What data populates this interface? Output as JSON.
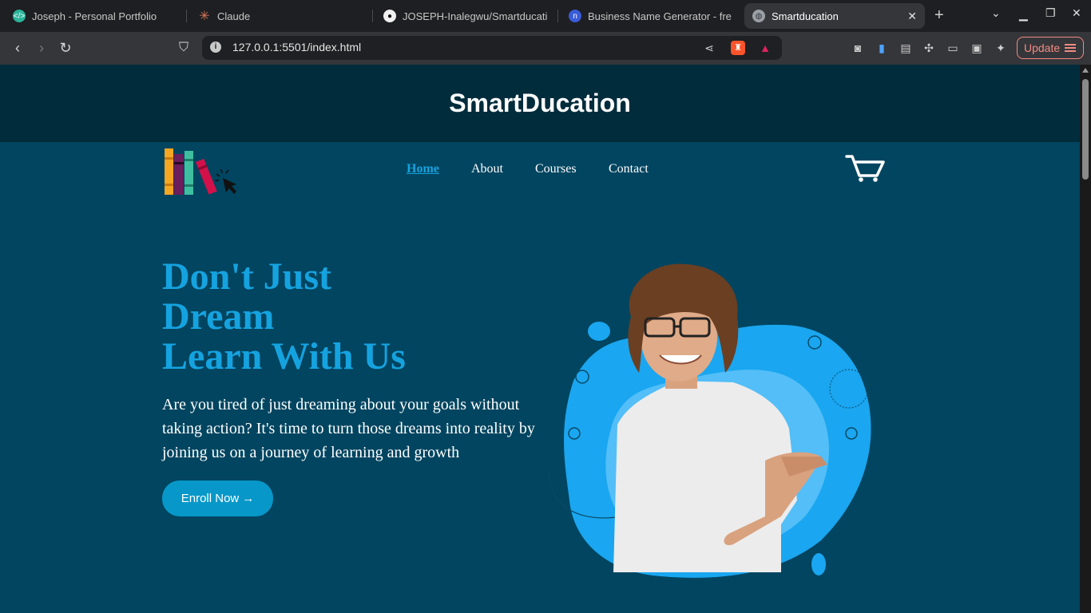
{
  "browser": {
    "tabs": [
      {
        "title": "Joseph - Personal Portfolio",
        "icon": "code-icon"
      },
      {
        "title": "Claude",
        "icon": "claude-icon"
      },
      {
        "title": "JOSEPH-Inalegwu/Smartducati",
        "icon": "github-icon"
      },
      {
        "title": "Business Name Generator - free",
        "icon": "namelix-icon"
      },
      {
        "title": "Smartducation",
        "icon": "globe-icon",
        "active": true
      }
    ],
    "url": "127.0.0.1:5501/index.html",
    "update_label": "Update"
  },
  "site": {
    "title": "SmartDucation",
    "nav": [
      "Home",
      "About",
      "Courses",
      "Contact"
    ],
    "hero": {
      "title_lines": [
        "Don't Just",
        "Dream",
        "Learn With Us"
      ],
      "text": "Are you tired of just dreaming about your goals without taking action? It's time to turn those dreams into reality by joining us on a journey of learning and growth",
      "cta": "Enroll Now"
    }
  },
  "colors": {
    "page_bg": "#014560",
    "header_bg": "#012c3c",
    "accent": "#15a3e0",
    "button": "#0798c9"
  }
}
